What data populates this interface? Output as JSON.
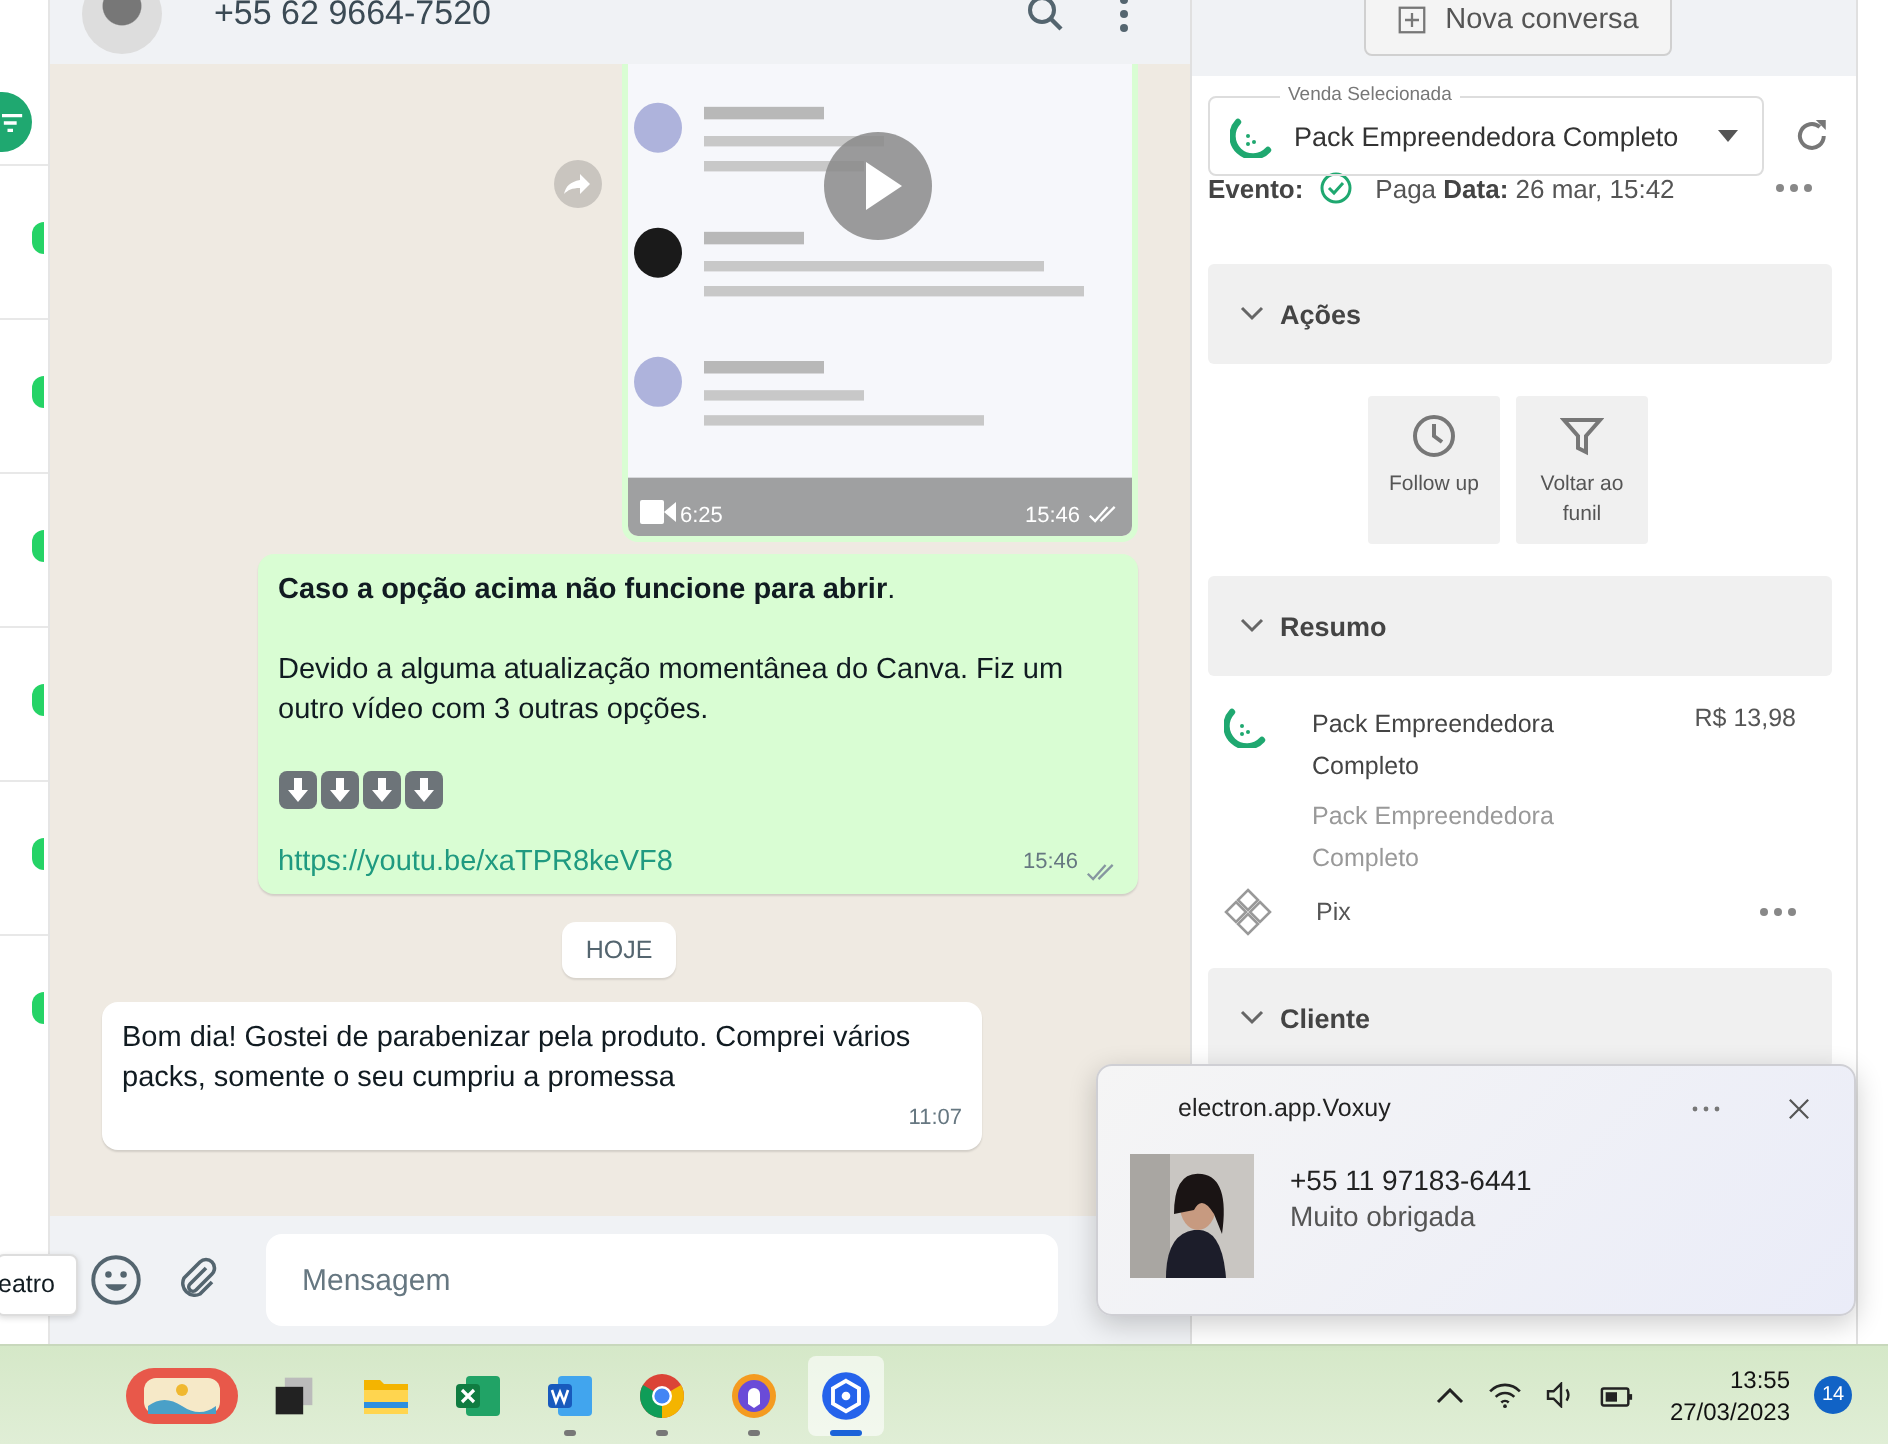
{
  "sidebar": {
    "items": [
      {
        "unread": true
      },
      {
        "unread": true
      },
      {
        "unread": true
      },
      {
        "unread": true
      },
      {
        "unread": true
      },
      {
        "unread": true
      }
    ]
  },
  "chat_header": {
    "phone": "+55 62 9664-7520"
  },
  "messages": [
    {
      "kind": "video",
      "duration": "6:25",
      "time": "15:46",
      "read": true
    },
    {
      "kind": "outgoing",
      "paragraphs": [
        "**Caso a opção acima não funcione para abrir**.",
        "Devido a alguma atualização momentânea do Canva. Fiz um outro vídeo com 3 outras opções."
      ],
      "emoji": [
        {
          "kind": "down_arrow"
        },
        {
          "kind": "down_arrow"
        },
        {
          "kind": "down_arrow"
        },
        {
          "kind": "down_arrow"
        }
      ],
      "link": "https://youtu.be/xaTPR8keVF8",
      "time": "15:46",
      "read": true
    },
    {
      "kind": "day",
      "label": "HOJE"
    },
    {
      "kind": "incoming",
      "paragraphs": [
        "Bom dia! Gostei de parabenizar pela produto. Comprei vários packs, somente o seu cumpriu a promessa"
      ],
      "time": "11:07",
      "read": false
    }
  ],
  "composer": {
    "placeholder": "Mensagem"
  },
  "tooltip": "eatro",
  "panel": {
    "new_chat": "Nova conversa",
    "sale_select": {
      "label": "Venda Selecionada",
      "value": "Pack Empreendedora Completo"
    },
    "event": {
      "label": "Evento:",
      "text": "Paga **Data:** 26 mar, 15:42"
    },
    "sections": [
      {
        "kind": "actions",
        "title": "Ações",
        "expanded": true,
        "actions": [
          {
            "label": "Follow up"
          },
          {
            "label": "Voltar ao funil"
          }
        ]
      },
      {
        "kind": "summary",
        "title": "Resumo",
        "expanded": true,
        "product": "Pack Empreendedora Completo",
        "price": "R$ 13,98",
        "subtitle": "Pack Empreendedora Completo",
        "payment": "Pix"
      },
      {
        "kind": "client",
        "title": "Cliente",
        "expanded": true
      }
    ]
  },
  "notification": {
    "app": "electron.app.Voxuy",
    "title": "+55 11 97183-6441",
    "body": "Muito obrigada"
  },
  "taskbar": {
    "apps": [
      {
        "kind": "widgets",
        "running": false,
        "selected": false
      },
      {
        "kind": "taskview",
        "running": false,
        "selected": false
      },
      {
        "kind": "folder",
        "running": false,
        "selected": false
      },
      {
        "kind": "excel",
        "running": false,
        "selected": false
      },
      {
        "kind": "word",
        "running": true,
        "selected": false
      },
      {
        "kind": "chrome",
        "running": true,
        "selected": false
      },
      {
        "kind": "browser",
        "running": true,
        "selected": false
      },
      {
        "kind": "voxuy",
        "running": true,
        "selected": true
      }
    ],
    "time": "13:55",
    "date": "27/03/2023",
    "badge": "14"
  }
}
